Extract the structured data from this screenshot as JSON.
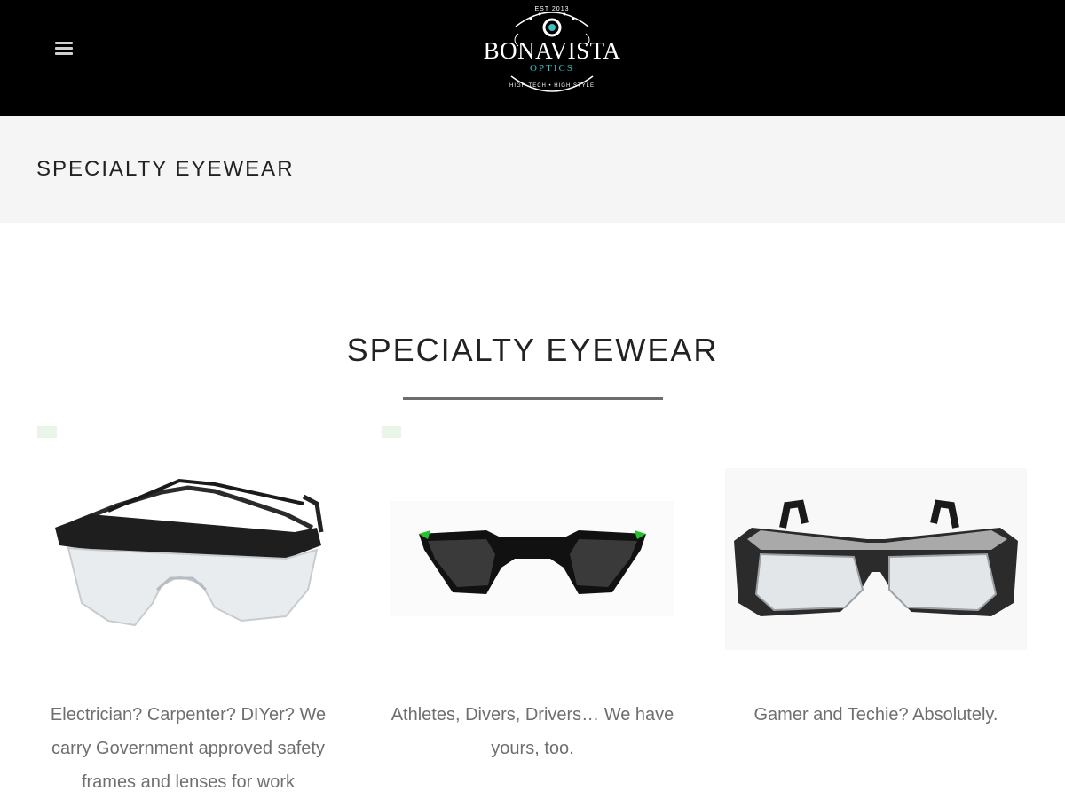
{
  "header": {
    "menu_icon": "hamburger-menu-icon",
    "logo": {
      "top_text": "EST 2013",
      "name": "BONAVISTA",
      "sub": "OPTICS",
      "tagline": "HIGH TECH • HIGH STYLE"
    }
  },
  "title_band": {
    "title": "SPECIALTY EYEWEAR"
  },
  "section": {
    "title": "SPECIALTY EYEWEAR"
  },
  "cards": [
    {
      "image_name": "safety-glasses",
      "caption": "Electrician? Carpenter? DIYer? We carry Government approved safety frames and lenses for work"
    },
    {
      "image_name": "sport-sunglasses",
      "caption": "Athletes, Divers, Drivers… We have yours, too."
    },
    {
      "image_name": "smart-glasses",
      "caption": "Gamer and Techie? Absolutely."
    }
  ],
  "colors": {
    "header_bg": "#000000",
    "title_band_bg": "#f5f5f5",
    "logo_accent": "#3fc0c7",
    "caption_text": "#6f6f6f"
  }
}
